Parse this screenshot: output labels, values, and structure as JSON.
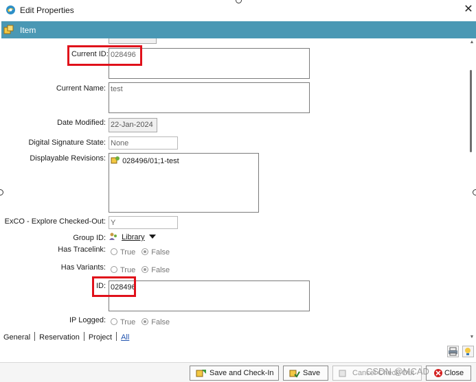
{
  "window": {
    "title": "Edit Properties"
  },
  "section": {
    "label": "Item"
  },
  "fields": {
    "current_id": {
      "label": "Current ID:",
      "value": "028496"
    },
    "current_name": {
      "label": "Current Name:",
      "value": "test"
    },
    "date_modified": {
      "label": "Date Modified:",
      "value": "22-Jan-2024"
    },
    "digital_signature_state": {
      "label": "Digital Signature State:",
      "value": "None"
    },
    "displayable_revisions": {
      "label": "Displayable Revisions:",
      "items": [
        "028496/01;1-test"
      ]
    },
    "exco_explore_checked_out": {
      "label": "ExCO - Explore Checked-Out:",
      "value": "Y"
    },
    "group_id": {
      "label": "Group ID:",
      "value": "Library"
    },
    "has_tracelink": {
      "label": "Has Tracelink:",
      "options": [
        "True",
        "False"
      ],
      "selected": "False"
    },
    "has_variants": {
      "label": "Has Variants:",
      "options": [
        "True",
        "False"
      ],
      "selected": "False"
    },
    "id": {
      "label": "ID:",
      "value": "028496"
    },
    "ip_logged": {
      "label": "IP Logged:",
      "options": [
        "True",
        "False"
      ],
      "selected": "False"
    }
  },
  "tabs": [
    {
      "label": "General",
      "active": false
    },
    {
      "label": "Reservation",
      "active": false
    },
    {
      "label": "Project",
      "active": false
    },
    {
      "label": "All",
      "active": true
    }
  ],
  "buttons": {
    "save_checkin": "Save and Check-In",
    "save": "Save",
    "cancel_checkout": "Cancel Check-Out",
    "close": "Close"
  },
  "watermark": "CSDN @MCAD",
  "colors": {
    "header": "#4a98b4",
    "highlight": "#e0101a",
    "tab_active": "#2255b0"
  },
  "icons": {
    "app": "teamcenter-app-icon",
    "item": "item-icon",
    "revision": "item-revision-icon",
    "group": "group-icon",
    "dropdown": "dropdown-arrow-icon",
    "save_checkin": "save-checkin-icon",
    "save": "save-icon",
    "cancel": "cancel-checkout-icon",
    "close": "close-icon"
  }
}
